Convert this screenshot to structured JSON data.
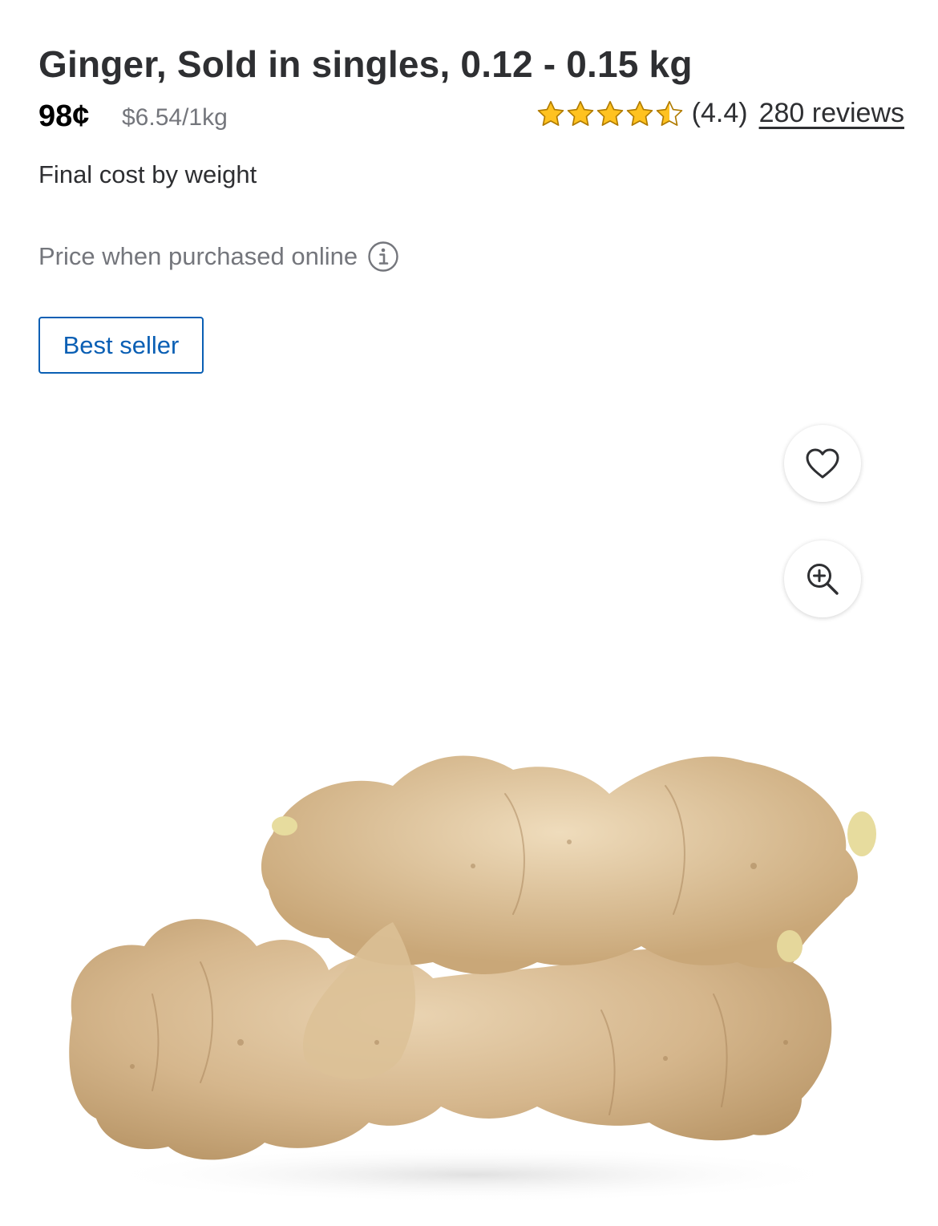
{
  "product": {
    "title": "Ginger, Sold in singles, 0.12 - 0.15 kg",
    "price": "98¢",
    "unit_price": "$6.54/1kg",
    "rating_text": "(4.4)",
    "rating_value": 4.4,
    "rating_max": 5,
    "reviews_label": "280 reviews",
    "final_cost_note": "Final cost by weight",
    "online_price_note": "Price when purchased online",
    "badge": "Best seller"
  },
  "icons": {
    "info": "info-icon",
    "favorite": "heart-icon",
    "zoom": "zoom-in-icon",
    "star": "star-icon"
  },
  "colors": {
    "text": "#2e2f32",
    "muted": "#74767c",
    "accent_blue": "#0a5fb4",
    "star": "#ffc220"
  }
}
